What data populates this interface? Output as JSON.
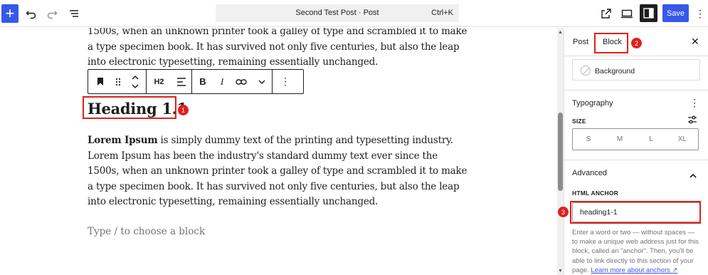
{
  "topbar": {
    "document_title": "Second Test Post · Post",
    "shortcut": "Ctrl+K",
    "save_label": "Save"
  },
  "editor": {
    "top_paragraph_lines": [
      "1500s, when an unknown printer took a galley of type and scrambled it to make",
      "a type specimen book. It has survived not only five centuries, but also the leap",
      "into electronic typesetting, remaining essentially unchanged."
    ],
    "block_toolbar": {
      "heading_level": "H2"
    },
    "heading": "Heading 1.1",
    "paragraph": {
      "bold_lead": "Lorem Ipsum",
      "line1_rest": " is simply dummy text of the printing and typesetting industry.",
      "lines": [
        "Lorem Ipsum has been the industry's standard dummy text ever since the",
        "1500s, when an unknown printer took a galley of type and scrambled it to make",
        "a type specimen book. It has survived not only five centuries, but also the leap",
        "into electronic typesetting, remaining essentially unchanged."
      ]
    },
    "placeholder": "Type / to choose a block"
  },
  "sidebar": {
    "tabs": [
      "Post",
      "Block"
    ],
    "active_tab": "Block",
    "background_label": "Background",
    "typography_title": "Typography",
    "size_label": "SIZE",
    "size_options": [
      "S",
      "M",
      "L",
      "XL"
    ],
    "advanced_title": "Advanced",
    "html_anchor_label": "HTML ANCHOR",
    "html_anchor_value": "heading1-1",
    "help_text": "Enter a word or two — without spaces — to make a unique web address just for this block, called an \"anchor\". Then, you'll be able to link directly to this section of your page.",
    "help_link": "Learn more about anchors ↗"
  },
  "annotations": [
    "1",
    "2",
    "3"
  ],
  "colors": {
    "accent": "#3858e9",
    "annotation": "#e0201b"
  }
}
